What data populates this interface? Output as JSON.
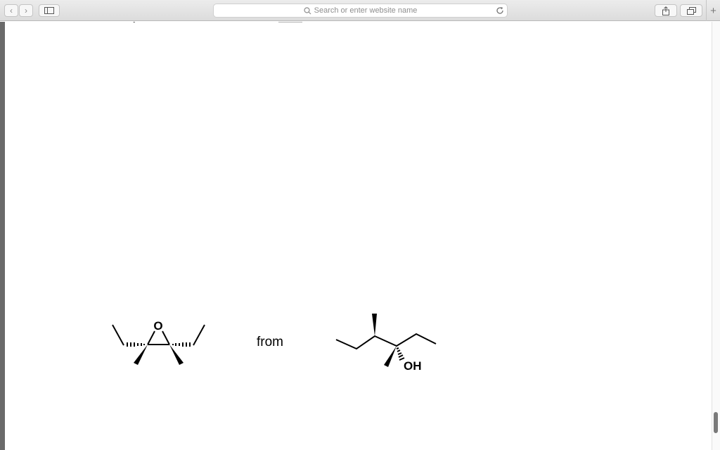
{
  "browser": {
    "address_placeholder": "Search or enter website name",
    "new_tab_symbol": "+",
    "back_symbol": "‹",
    "forward_symbol": "›"
  },
  "page": {
    "connector_text": "from",
    "oxygen_label": "O",
    "hydroxyl_label": "OH"
  }
}
